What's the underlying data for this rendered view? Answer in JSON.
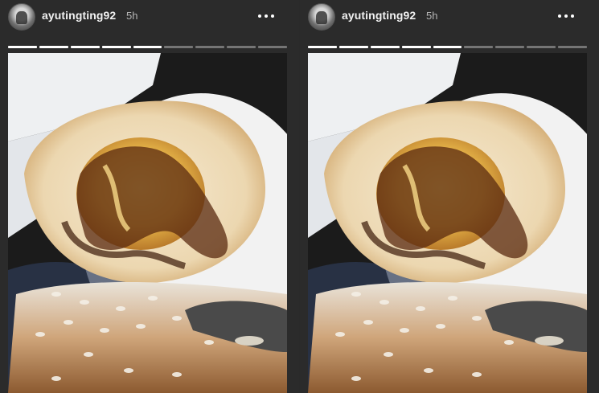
{
  "stories": [
    {
      "username": "ayutingting92",
      "time": "5h",
      "progress": {
        "total": 9,
        "viewed": 5
      },
      "image_subject": "fried egg on rice with sweet soy sauce"
    },
    {
      "username": "ayutingting92",
      "time": "5h",
      "progress": {
        "total": 9,
        "viewed": 5
      },
      "image_subject": "fried egg on rice with sweet soy sauce"
    }
  ],
  "icons": {
    "more": "more-options-icon",
    "avatar": "profile-avatar"
  },
  "colors": {
    "background": "#2b2b2b",
    "progress_active": "#ffffff",
    "progress_inactive": "rgba(255,255,255,0.35)"
  }
}
